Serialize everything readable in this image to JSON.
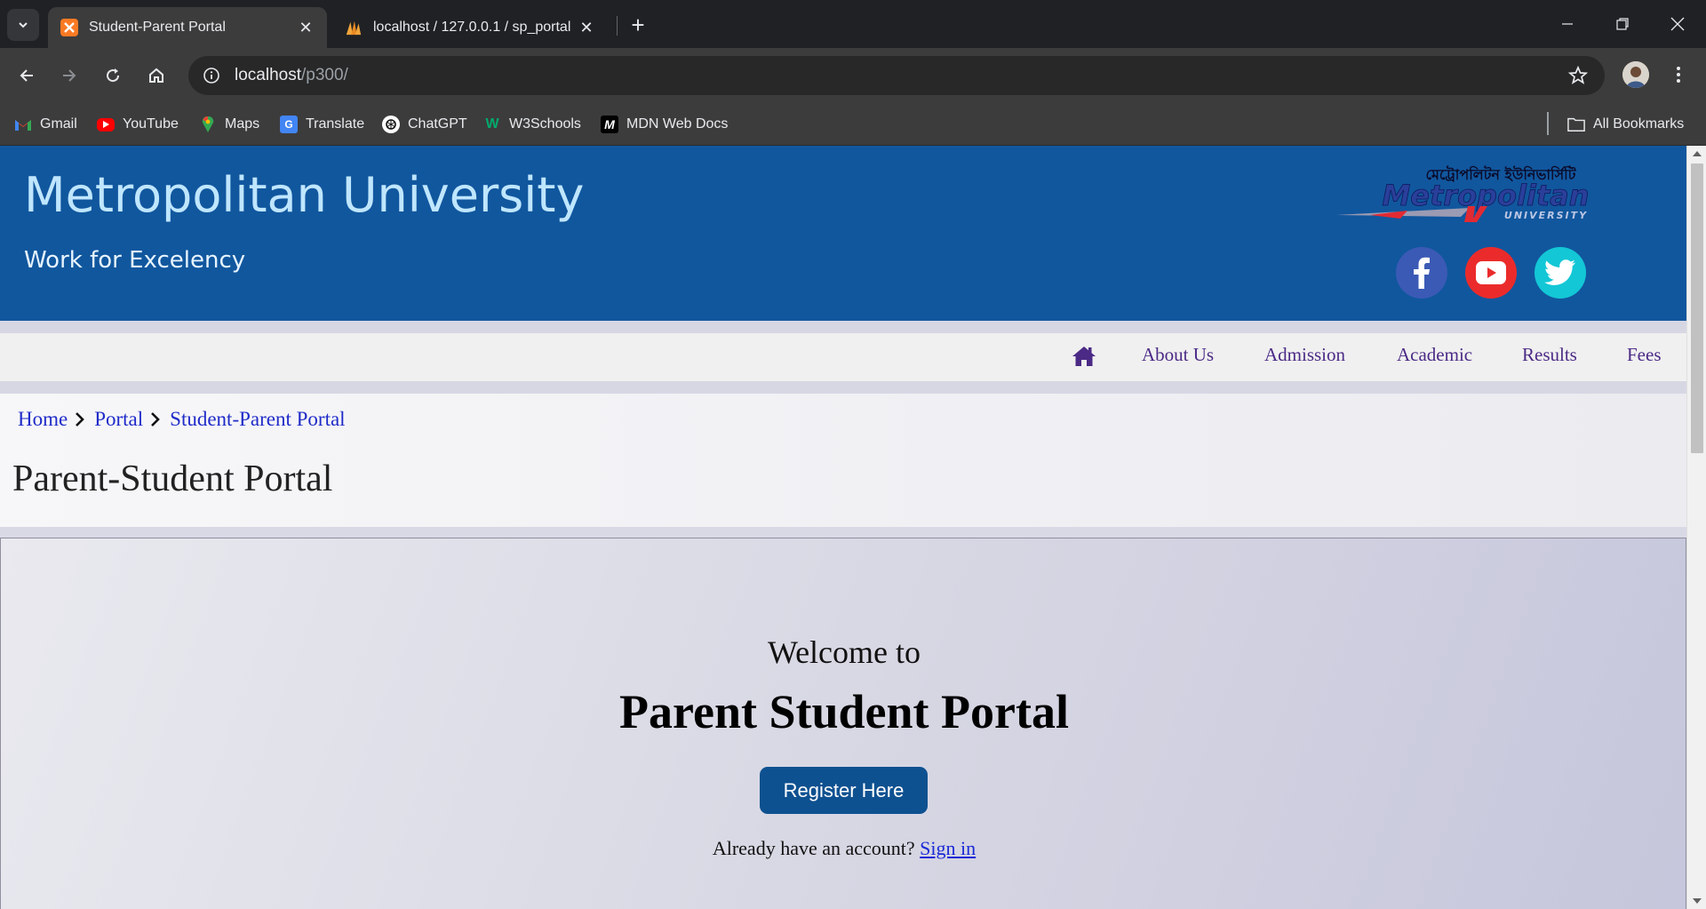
{
  "browser": {
    "tabs": [
      {
        "title": "Student-Parent Portal",
        "active": true,
        "icon": "xampp-icon"
      },
      {
        "title": "localhost / 127.0.0.1 / sp_portal",
        "active": false,
        "icon": "phpmyadmin-icon"
      }
    ],
    "url_host": "localhost",
    "url_path": "/p300/",
    "bookmarks": [
      {
        "label": "Gmail",
        "icon": "gmail-icon"
      },
      {
        "label": "YouTube",
        "icon": "youtube-icon"
      },
      {
        "label": "Maps",
        "icon": "maps-icon"
      },
      {
        "label": "Translate",
        "icon": "translate-icon"
      },
      {
        "label": "ChatGPT",
        "icon": "chatgpt-icon"
      },
      {
        "label": "W3Schools",
        "icon": "w3schools-icon"
      },
      {
        "label": "MDN Web Docs",
        "icon": "mdn-icon"
      }
    ],
    "all_bookmarks": "All Bookmarks"
  },
  "header": {
    "title": "Metropolitan University",
    "tagline": "Work for Excelency",
    "logo_top": "মেট্রোপলিটন ইউনিভার্সিটি",
    "logo_main": "Metropolitan",
    "logo_sub": "UNIVERSITY",
    "social": [
      "facebook-icon",
      "youtube-icon",
      "twitter-icon"
    ]
  },
  "nav": {
    "items": [
      "About Us",
      "Admission",
      "Academic",
      "Results",
      "Fees"
    ]
  },
  "breadcrumb": {
    "items": [
      "Home",
      "Portal",
      "Student-Parent Portal"
    ]
  },
  "page_title": "Parent-Student Portal",
  "hero": {
    "subtitle": "Welcome to",
    "title": "Parent Student Portal",
    "register_label": "Register Here",
    "signin_prompt": "Already have an account?",
    "signin_link": "Sign in"
  },
  "colors": {
    "header_bg": "#11579e",
    "nav_link": "#4b2a86",
    "breadcrumb_link": "#1f2bc8",
    "button_bg": "#0e5190"
  }
}
